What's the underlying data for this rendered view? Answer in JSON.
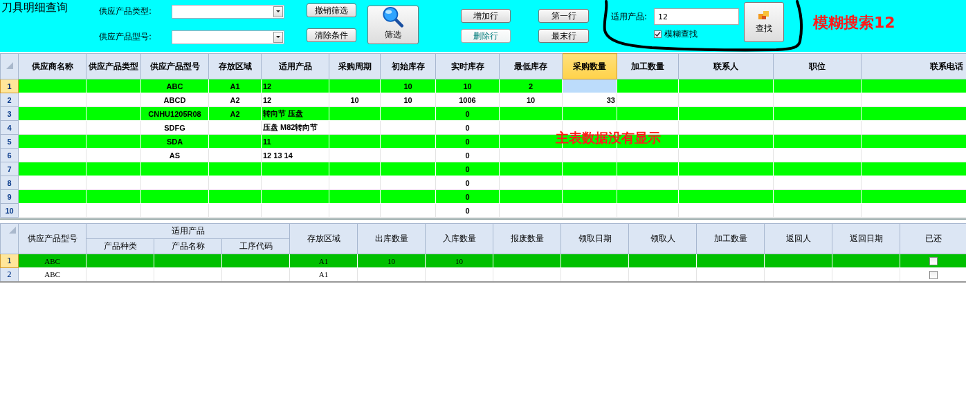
{
  "window": {
    "title": "刀具明细查询"
  },
  "filters": [
    {
      "label": "供应产品类型:"
    },
    {
      "label": "供应产品型号:"
    }
  ],
  "filter_buttons": [
    {
      "label": "撤销筛选"
    },
    {
      "label": "清除条件"
    }
  ],
  "filter_button": {
    "label": "筛选"
  },
  "row_buttons": [
    {
      "label": "增加行",
      "hovered": false
    },
    {
      "label": "删除行",
      "hovered": true
    }
  ],
  "nav_buttons": [
    {
      "label": "第一行"
    },
    {
      "label": "最末行"
    }
  ],
  "search": {
    "label": "适用产品:",
    "value": "12",
    "fuzzy": {
      "label": "模糊查找",
      "checked": true
    },
    "button": "查找"
  },
  "annotations": [
    {
      "text": "模糊搜索12"
    },
    {
      "text": "主表数据没有显示"
    }
  ],
  "main_table": {
    "columns": [
      {
        "label": "供应商名称",
        "selected": false
      },
      {
        "label": "供应产品类型",
        "selected": false
      },
      {
        "label": "供应产品型号",
        "selected": false
      },
      {
        "label": "存放区域",
        "selected": false
      },
      {
        "label": "适用产品",
        "selected": false
      },
      {
        "label": "采购周期",
        "selected": false
      },
      {
        "label": "初始库存",
        "selected": false
      },
      {
        "label": "实时库存",
        "selected": false
      },
      {
        "label": "最低库存",
        "selected": false
      },
      {
        "label": "采购数量",
        "selected": true
      },
      {
        "label": "加工数量",
        "selected": false
      },
      {
        "label": "联系人",
        "selected": false
      },
      {
        "label": "职位",
        "selected": false
      },
      {
        "label": "联系电话",
        "selected": false
      }
    ],
    "rows": [
      {
        "number": "1",
        "selected": true,
        "cells": [
          null,
          null,
          "ABC",
          "A1",
          "12",
          null,
          "10",
          "10",
          "2",
          null,
          null,
          null,
          null,
          null
        ]
      },
      {
        "number": "2",
        "selected": false,
        "cells": [
          null,
          null,
          "ABCD",
          "A2",
          "12",
          "10",
          "10",
          "1006",
          "10",
          "33",
          null,
          null,
          null,
          null
        ]
      },
      {
        "number": "3",
        "selected": false,
        "cells": [
          null,
          null,
          "CNHU1205R08",
          "A2",
          "转向节 压盘",
          null,
          null,
          "0",
          null,
          null,
          null,
          null,
          null,
          null
        ]
      },
      {
        "number": "4",
        "selected": false,
        "cells": [
          null,
          null,
          "SDFG",
          null,
          "压盘 M82转向节",
          null,
          null,
          "0",
          null,
          null,
          null,
          null,
          null,
          null
        ]
      },
      {
        "number": "5",
        "selected": false,
        "cells": [
          null,
          null,
          "SDA",
          null,
          "11",
          null,
          null,
          "0",
          null,
          null,
          null,
          null,
          null,
          null
        ]
      },
      {
        "number": "6",
        "selected": false,
        "cells": [
          null,
          null,
          "AS",
          null,
          "12 13 14",
          null,
          null,
          "0",
          null,
          null,
          null,
          null,
          null,
          null
        ]
      },
      {
        "number": "7",
        "selected": false,
        "cells": [
          null,
          null,
          null,
          null,
          null,
          null,
          null,
          "0",
          null,
          null,
          null,
          null,
          null,
          null
        ]
      },
      {
        "number": "8",
        "selected": false,
        "cells": [
          null,
          null,
          null,
          null,
          null,
          null,
          null,
          "0",
          null,
          null,
          null,
          null,
          null,
          null
        ]
      },
      {
        "number": "9",
        "selected": false,
        "cells": [
          null,
          null,
          null,
          null,
          null,
          null,
          null,
          "0",
          null,
          null,
          null,
          null,
          null,
          null
        ]
      },
      {
        "number": "10",
        "selected": false,
        "cells": [
          null,
          null,
          null,
          null,
          null,
          null,
          null,
          "0",
          null,
          null,
          null,
          null,
          null,
          null
        ]
      }
    ]
  },
  "detail_table": {
    "group_header": {
      "label": "适用产品"
    },
    "columns": [
      {
        "label": "供应产品型号"
      },
      {
        "label": "产品种类",
        "grouped": true
      },
      {
        "label": "产品名称",
        "grouped": true
      },
      {
        "label": "工序代码",
        "grouped": true
      },
      {
        "label": "存放区域"
      },
      {
        "label": "出库数量"
      },
      {
        "label": "入库数量"
      },
      {
        "label": "报废数量"
      },
      {
        "label": "领取日期"
      },
      {
        "label": "领取人"
      },
      {
        "label": "加工数量"
      },
      {
        "label": "返回人"
      },
      {
        "label": "返回日期"
      },
      {
        "label": "已还",
        "kind": "checkbox"
      }
    ],
    "rows": [
      {
        "number": "1",
        "selected": true,
        "cells": [
          "ABC",
          null,
          null,
          null,
          "A1",
          "10",
          "10",
          null,
          null,
          null,
          null,
          null,
          null
        ],
        "returned": false
      },
      {
        "number": "2",
        "selected": false,
        "cells": [
          "ABC",
          null,
          null,
          null,
          "A1",
          null,
          null,
          null,
          null,
          null,
          null,
          null,
          null
        ],
        "returned": false
      }
    ]
  }
}
